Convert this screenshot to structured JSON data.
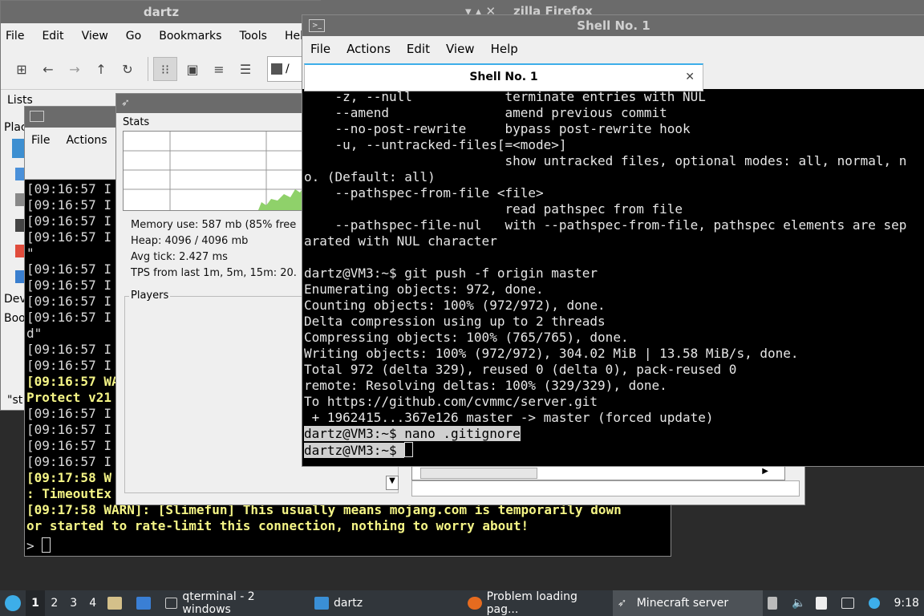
{
  "file_manager": {
    "title": "dartz",
    "menu": [
      "File",
      "Edit",
      "View",
      "Go",
      "Bookmarks",
      "Tools",
      "Hel"
    ],
    "path": "/",
    "side_lists": "Lists",
    "side_places": "Plac",
    "side_devices": "Dev",
    "side_bookmarks": "Boo",
    "status_fragment": "\"st"
  },
  "firefox_title": "zilla Firefox",
  "mc_terminal": {
    "menu": [
      "File",
      "Actions"
    ],
    "lines": [
      {
        "t": "[09:16:57 I",
        "w": false
      },
      {
        "t": "[09:16:57 I",
        "w": false
      },
      {
        "t": "[09:16:57 I",
        "w": false
      },
      {
        "t": "[09:16:57 I",
        "w": false
      },
      {
        "t": "\"",
        "w": false
      },
      {
        "t": "[09:16:57 I",
        "w": false
      },
      {
        "t": "[09:16:57 I",
        "w": false
      },
      {
        "t": "[09:16:57 I",
        "w": false
      },
      {
        "t": "[09:16:57 I",
        "w": false
      },
      {
        "t": "d\"",
        "w": false
      },
      {
        "t": "[09:16:57 I",
        "w": false
      },
      {
        "t": "[09:16:57 I",
        "w": false
      },
      {
        "t": "[09:16:57 WA",
        "w": true
      },
      {
        "t": "Protect v21",
        "w": true
      },
      {
        "t": "[09:16:57 I",
        "w": false
      },
      {
        "t": "[09:16:57 I",
        "w": false
      },
      {
        "t": "[09:16:57 I",
        "w": false
      },
      {
        "t": "[09:16:57 I",
        "w": false
      },
      {
        "t": "[09:17:58 W",
        "w": true
      },
      {
        "t": ": TimeoutEx",
        "w": true
      },
      {
        "t": "[09:17:58 WARN]: [Slimefun] This usually means mojang.com is temporarily down",
        "w": true
      },
      {
        "t": "or started to rate-limit this connection, nothing to worry about!",
        "w": true
      }
    ],
    "prompt": "> "
  },
  "mc_gui": {
    "stats_label": "Stats",
    "memory": "Memory use: 587 mb (85% free",
    "heap": "Heap: 4096 / 4096 mb",
    "avg_tick": "Avg tick: 2.427 ms",
    "tps": "TPS from last 1m, 5m, 15m: 20.",
    "players_label": "Players"
  },
  "shell": {
    "title": "Shell No. 1",
    "menu": [
      "File",
      "Actions",
      "Edit",
      "View",
      "Help"
    ],
    "tab_label": "Shell No. 1",
    "lines": [
      "    -z, --null            terminate entries with NUL",
      "    --amend               amend previous commit",
      "    --no-post-rewrite     bypass post-rewrite hook",
      "    -u, --untracked-files[=<mode>]",
      "                          show untracked files, optional modes: all, normal, n",
      "o. (Default: all)",
      "    --pathspec-from-file <file>",
      "                          read pathspec from file",
      "    --pathspec-file-nul   with --pathspec-from-file, pathspec elements are sep",
      "arated with NUL character",
      "",
      "dartz@VM3:~$ git push -f origin master",
      "Enumerating objects: 972, done.",
      "Counting objects: 100% (972/972), done.",
      "Delta compression using up to 2 threads",
      "Compressing objects: 100% (765/765), done.",
      "Writing objects: 100% (972/972), 304.02 MiB | 13.58 MiB/s, done.",
      "Total 972 (delta 329), reused 0 (delta 0), pack-reused 0",
      "remote: Resolving deltas: 100% (329/329), done.",
      "To https://github.com/cvmmc/server.git",
      " + 1962415...367e126 master -> master (forced update)",
      "dartz@VM3:~$ nano .gitignore"
    ],
    "prompt": "dartz@VM3:~$ "
  },
  "taskbar": {
    "workspaces": [
      "1",
      "2",
      "3",
      "4"
    ],
    "tasks": [
      {
        "label": "qterminal - 2 windows",
        "icon": "terminal-icon"
      },
      {
        "label": "dartz",
        "icon": "folder-icon"
      },
      {
        "label": "Problem loading pag...",
        "icon": "firefox-icon"
      },
      {
        "label": "Minecraft server",
        "icon": "java-icon"
      }
    ],
    "clock": "9:18"
  }
}
